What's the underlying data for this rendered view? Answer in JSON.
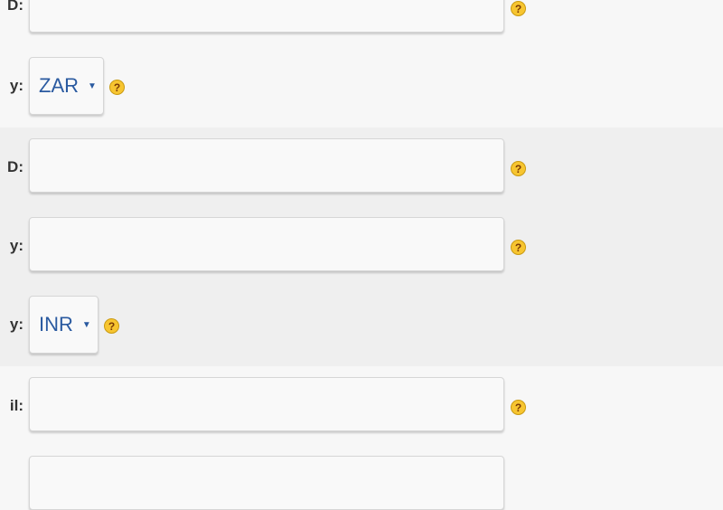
{
  "form": {
    "row1": {
      "label": "D:",
      "value": "",
      "help": "?"
    },
    "row2": {
      "label": "y:",
      "selected": "ZAR",
      "caret": "▼",
      "help": "?"
    },
    "row3": {
      "label": "D:",
      "value": "",
      "help": "?"
    },
    "row4": {
      "label": "y:",
      "value": "",
      "help": "?"
    },
    "row5": {
      "label": "y:",
      "selected": "INR",
      "caret": "▼",
      "help": "?"
    },
    "row6": {
      "label": "il:",
      "value": "",
      "help": "?"
    },
    "row7": {
      "value": ""
    }
  },
  "colors": {
    "page_bg": "#f7f7f7",
    "band_bg": "#efefef",
    "select_text": "#2a5aa0",
    "help_fill": "#f7c530"
  },
  "icons": {
    "help": "help-icon",
    "caret": "chevron-down-icon"
  }
}
